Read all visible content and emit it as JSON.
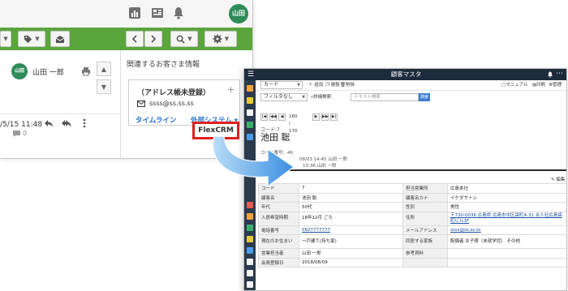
{
  "left_window": {
    "user_avatar": "山田",
    "sender_name": "山田 一郎",
    "sender_avatar": "山田",
    "mail_datetime": "/5/15 11:48",
    "reply_count": "0",
    "related_title": "関連するお客さま情報",
    "card": {
      "title": "（アドレス帳未登録）",
      "plus": "+",
      "email": "ssss@ss.ss.ss",
      "timeline_link": "タイムライン",
      "external_link": "外部システム ▾"
    },
    "flexcrm_button": "FlexCRM"
  },
  "right_window": {
    "title": "顧客マスタ",
    "menu_glyph": "☰",
    "more_glyph": "⋯",
    "toolbar1": {
      "select_value": "カード",
      "new_btn": "＋ 追加",
      "copy_btn": "複製",
      "delete_btn": "削除",
      "manual_btn": "マニュアル",
      "print_btn": "印刷",
      "manage_btn": "管理"
    },
    "toolbar2": {
      "filter_value": "フィルタなし",
      "detail_search": "詳細検索",
      "search_placeholder": "テキスト検索",
      "search_btn": "検索"
    },
    "pager": {
      "first": "|◀",
      "prev_page": "◀◀",
      "prev": "◀",
      "count": "160 / 170",
      "next": "▶",
      "next_page": "▶▶",
      "last": "▶|"
    },
    "record": {
      "code_label": "コード:7",
      "name": "池田 聡",
      "meta1": "コード番号：46",
      "meta2": "08/03 14:45 山田 一郎",
      "meta3": "13:36 山田 一郎"
    },
    "edit_link": "✎ 編集",
    "table": [
      {
        "l1": "コード",
        "v1": "7",
        "l2": "担当営業所",
        "v2": "広島本社"
      },
      {
        "l1": "顧客名",
        "v1": "池田 聡",
        "l2": "顧客名カナ",
        "v2": "イケダサトシ"
      },
      {
        "l1": "年代",
        "v1": "50代",
        "l2": "性別",
        "v2": "男性"
      },
      {
        "l1": "入居希望時期",
        "v1": "18年12月 ごろ",
        "l2": "住所",
        "v2": "〒730-0036 広島県 広島市中区袋町4-31 合人社広島袋町ビル3F"
      },
      {
        "l1": "電話番号",
        "v1": "0827777777",
        "l2": "メールアドレス",
        "v2": "ssss@ss.ss.ss"
      },
      {
        "l1": "現在のお住まい",
        "v1": "一戸建て(持ち家)",
        "l2": "同居する家族",
        "v2": "配偶者 お子様（未就学児） その他"
      },
      {
        "l1": "営業担当者",
        "v1": "山田 一郎",
        "l2": "参考資料",
        "v2": ""
      },
      {
        "l1": "会員登録日",
        "v1": "2018/08/09",
        "l2": "",
        "v2": ""
      }
    ]
  },
  "colors": {
    "green_bar": "#5aa53c",
    "highlight_red": "#e02020",
    "link_blue": "#1f73d1",
    "arrow_blue": "#3a8fe0",
    "crm_titlebar": "#1e2b3c"
  }
}
